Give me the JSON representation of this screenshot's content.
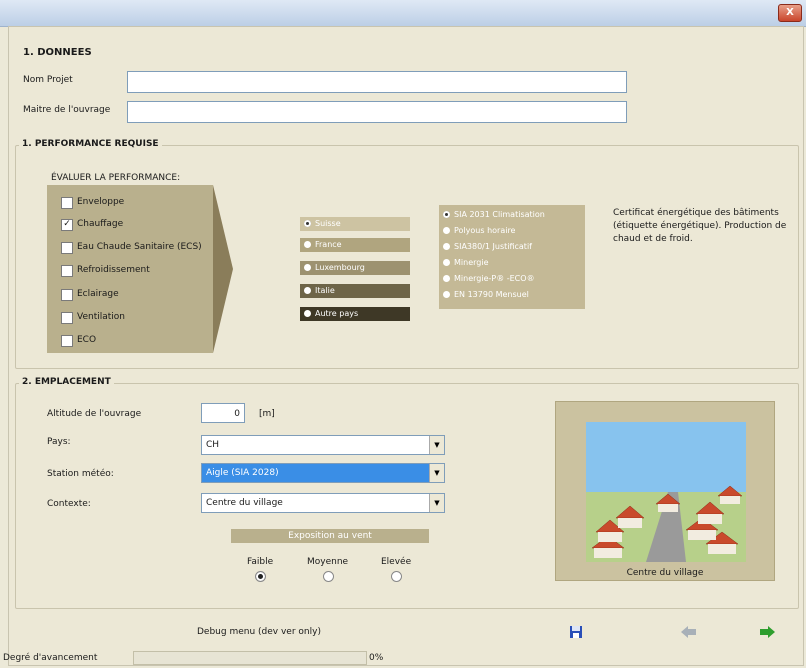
{
  "window": {
    "close_label": "X"
  },
  "section_data": {
    "title": "1.  DONNEES",
    "nom_projet_label": "Nom Projet",
    "maitre_label": "Maitre de l'ouvrage",
    "nom_projet_value": "",
    "maitre_value": ""
  },
  "performance": {
    "group_title": "1. PERFORMANCE REQUISE",
    "evaluate_label": "ÉVALUER LA PERFORMANCE:",
    "checks": [
      {
        "label": "Enveloppe",
        "checked": false
      },
      {
        "label": "Chauffage",
        "checked": true
      },
      {
        "label": "Eau Chaude Sanitaire (ECS)",
        "checked": false
      },
      {
        "label": "Refroidissement",
        "checked": false
      },
      {
        "label": "Eclairage",
        "checked": false
      },
      {
        "label": "Ventilation",
        "checked": false
      },
      {
        "label": "ECO",
        "checked": false
      }
    ],
    "check_marks": [
      "",
      "✓",
      "",
      "",
      "",
      "",
      ""
    ],
    "countries": [
      "Suisse",
      "France",
      "Luxembourg",
      "Italie",
      "Autre pays"
    ],
    "selected_country": "Suisse",
    "standards": [
      "SIA 2031 Climatisation",
      "Polyous horaire",
      "SIA380/1 Justificatif",
      "Minergie",
      "Minergie-P® -ECO®",
      "EN 13790 Mensuel"
    ],
    "selected_standard": "SIA 2031 Climatisation",
    "description": "Certificat énergétique des bâtiments (étiquette énergétique). Production de chaud et de froid."
  },
  "emplacement": {
    "group_title": "2. EMPLACEMENT",
    "altitude_label": "Altitude de l'ouvrage",
    "altitude_value": "0",
    "altitude_unit": "[m]",
    "pays_label": "Pays:",
    "pays_value": "CH",
    "station_label": "Station météo:",
    "station_value": "Aigle (SIA 2028)",
    "contexte_label": "Contexte:",
    "contexte_value": "Centre du village",
    "exposition_title": "Exposition au vent",
    "exposition_options": [
      "Faible",
      "Moyenne",
      "Elevée"
    ],
    "exposition_selected": "Faible",
    "image_caption": "Centre du village"
  },
  "footer": {
    "debug_label": "Debug menu (dev ver only)",
    "progress_label": "Degré d'avancement",
    "progress_value": "0%",
    "progress_fraction": 0
  },
  "colors": {
    "accent_blue": "#3a8ee6",
    "panel_tan": "#b9b08d",
    "nav_green": "#2e9e2e"
  }
}
